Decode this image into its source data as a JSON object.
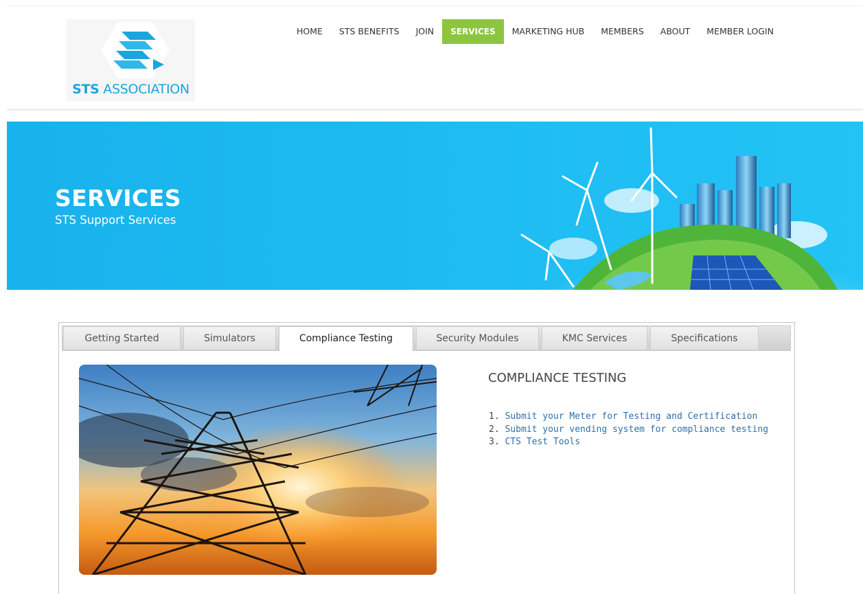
{
  "brand": {
    "name_bold": "STS",
    "name_rest": " ASSOCIATION"
  },
  "nav": {
    "items": [
      {
        "label": "HOME"
      },
      {
        "label": "STS BENEFITS"
      },
      {
        "label": "JOIN"
      },
      {
        "label": "SERVICES",
        "active": true
      },
      {
        "label": "MARKETING HUB"
      },
      {
        "label": "MEMBERS"
      },
      {
        "label": "ABOUT"
      },
      {
        "label": "MEMBER LOGIN"
      }
    ],
    "active_color": "#8cc63f"
  },
  "banner": {
    "title": "SERVICES",
    "subtitle": "STS Support Services",
    "background": "#1cb8f0"
  },
  "tabs": [
    {
      "label": "Getting Started"
    },
    {
      "label": "Simulators"
    },
    {
      "label": "Compliance Testing",
      "active": true
    },
    {
      "label": "Security Modules"
    },
    {
      "label": "KMC Services"
    },
    {
      "label": "Specifications"
    }
  ],
  "content": {
    "heading": "COMPLIANCE TESTING",
    "links": [
      {
        "num": "1.",
        "text": "Submit your Meter for Testing and Certification"
      },
      {
        "num": "2.",
        "text": "Submit your vending system for compliance testing"
      },
      {
        "num": "3.",
        "text": "CTS Test Tools"
      }
    ],
    "link_color": "#2e6fa8"
  },
  "icons": [
    "sts-logo-icon"
  ]
}
